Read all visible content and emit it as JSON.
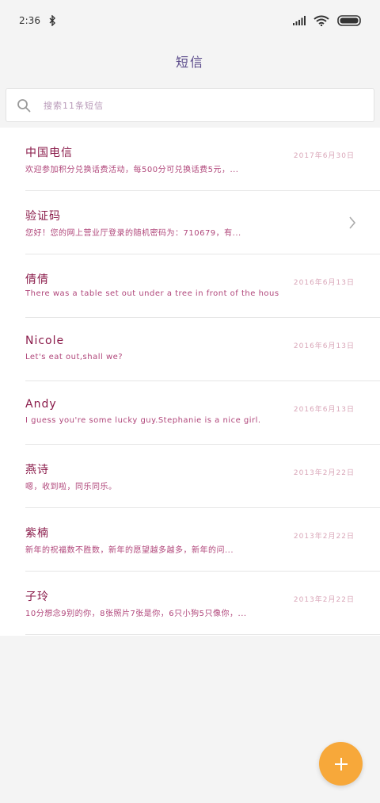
{
  "status": {
    "time": "2:36",
    "icons": [
      "bluetooth-icon",
      "signal-icon",
      "wifi-icon",
      "battery-icon"
    ]
  },
  "header": {
    "title": "短信"
  },
  "search": {
    "placeholder": "搜索11条短信"
  },
  "messages": [
    {
      "name": "中国电信",
      "date": "2017年6月30日",
      "preview": "欢迎参加积分兑换话费活动，每500分可兑换话费5元，...",
      "has_chevron": false
    },
    {
      "name": "验证码",
      "date": "",
      "preview": "您好！您的网上营业厅登录的随机密码为：710679，有...",
      "has_chevron": true
    },
    {
      "name": "倩倩",
      "date": "2016年6月13日",
      "preview": "There was a table set out under a tree in front of the hous",
      "has_chevron": false
    },
    {
      "name": "Nicole",
      "date": "2016年6月13日",
      "preview": "Let's eat out,shall we?",
      "has_chevron": false
    },
    {
      "name": "Andy",
      "date": "2016年6月13日",
      "preview": "I guess you're some lucky guy.Stephanie is a nice girl.",
      "has_chevron": false
    },
    {
      "name": "燕诗",
      "date": "2013年2月22日",
      "preview": "嗯，收到啦，同乐同乐。",
      "has_chevron": false
    },
    {
      "name": "紫楠",
      "date": "2013年2月22日",
      "preview": "新年的祝福数不胜数，新年的愿望越多越多，新年的问...",
      "has_chevron": false
    },
    {
      "name": "子玲",
      "date": "2013年2月22日",
      "preview": "10分想念9别的你，8张照片7张是你，6只小狗5只像你，...",
      "has_chevron": false
    }
  ],
  "fab": {
    "label": "+"
  },
  "colors": {
    "accent": "#f7a83a",
    "name": "#8a1b4a",
    "preview": "#b0467a",
    "date": "#d9a6b8"
  }
}
